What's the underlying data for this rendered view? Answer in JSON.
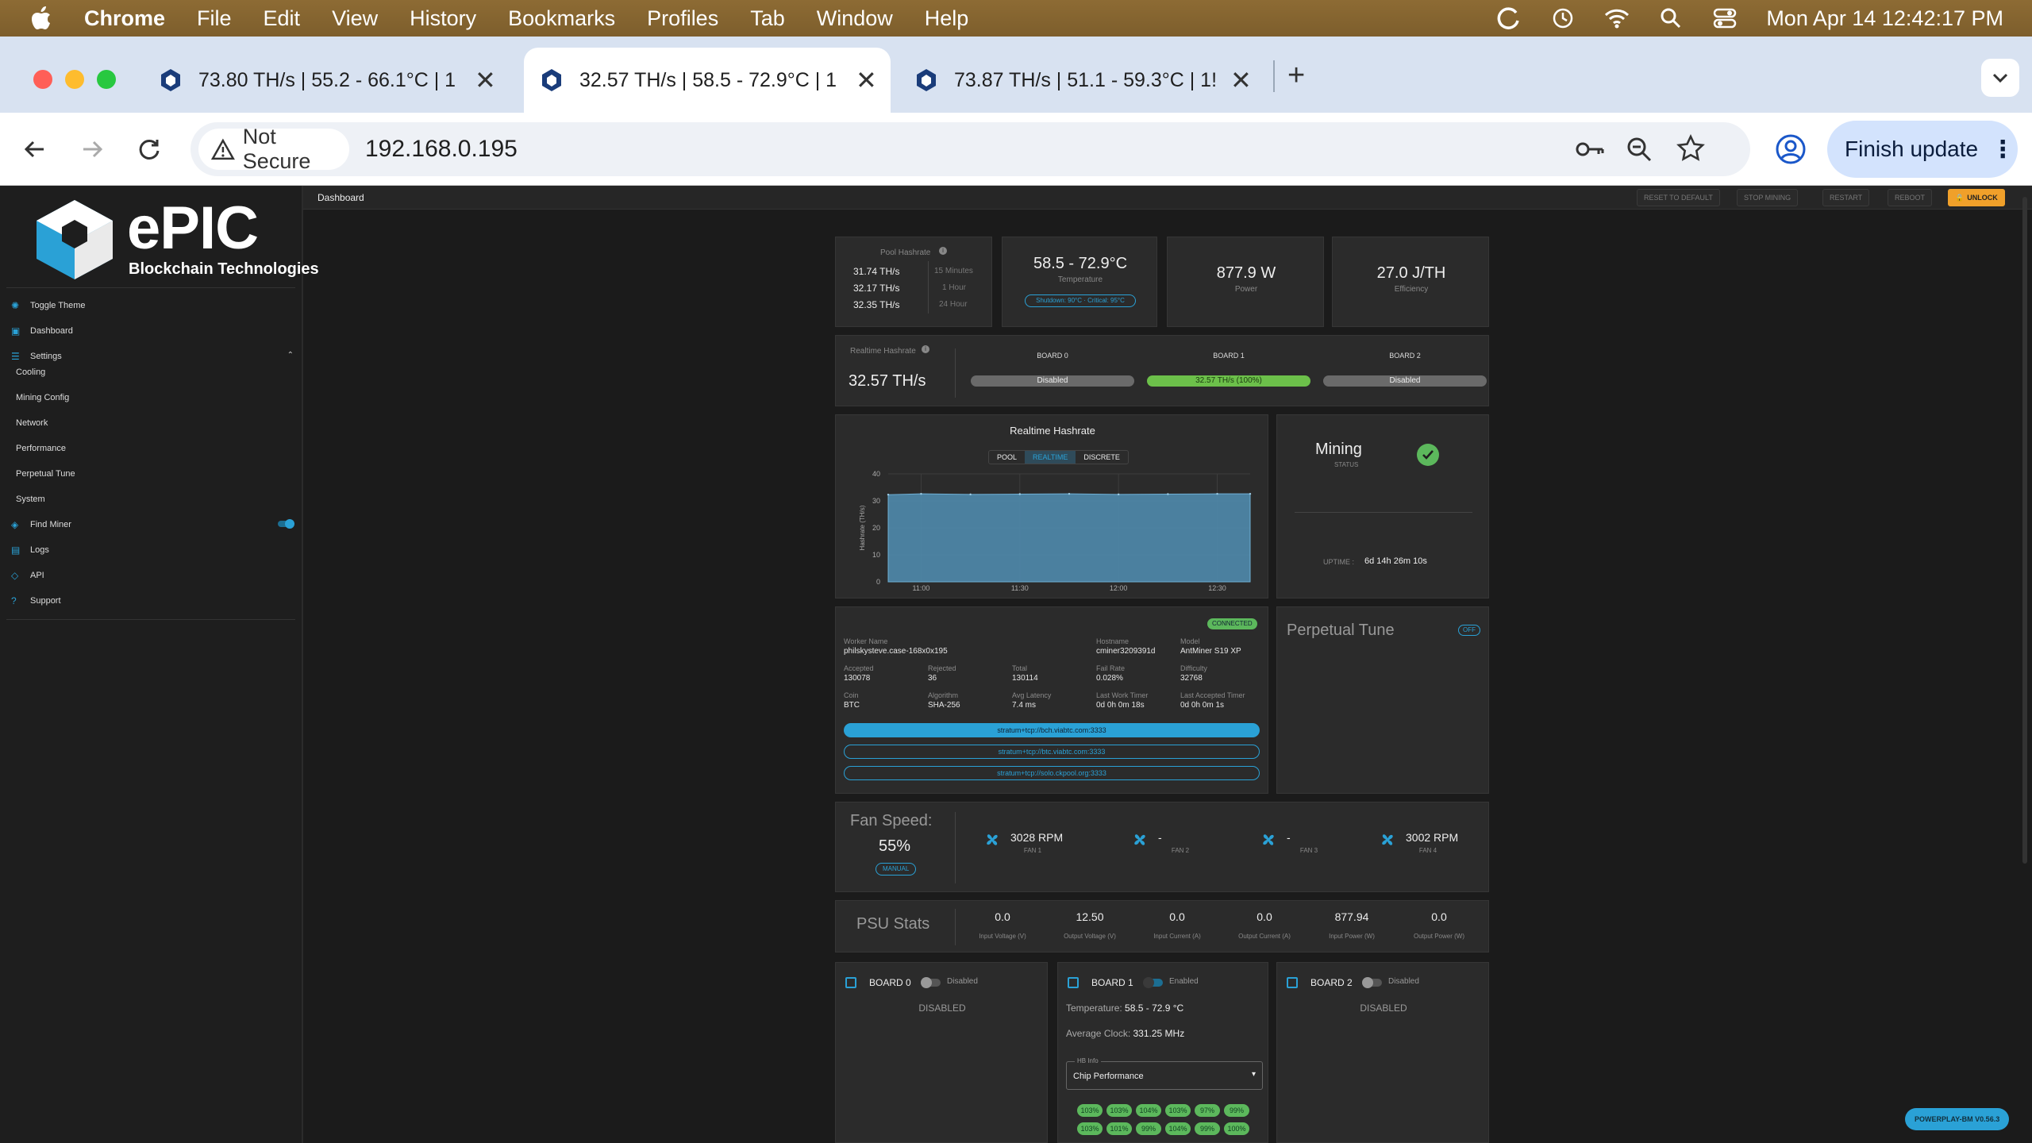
{
  "menubar": {
    "app": "Chrome",
    "items": [
      "File",
      "Edit",
      "View",
      "History",
      "Bookmarks",
      "Profiles",
      "Tab",
      "Window",
      "Help"
    ],
    "clock": "Mon Apr 14  12:42:17 PM"
  },
  "tabs": [
    {
      "title": "73.80 TH/s | 55.2 - 66.1°C | 1",
      "active": false
    },
    {
      "title": "32.57 TH/s | 58.5 - 72.9°C | 1",
      "active": true
    },
    {
      "title": "73.87 TH/s | 51.1 - 59.3°C | 1!",
      "active": false
    }
  ],
  "toolbar": {
    "security": "Not Secure",
    "url": "192.168.0.195",
    "finish_update": "Finish update"
  },
  "brand": {
    "name": "ePIC",
    "tagline": "Blockchain Technologies"
  },
  "sidebar": {
    "items": [
      {
        "label": "Toggle Theme",
        "icon": "sun-icon"
      },
      {
        "label": "Dashboard",
        "icon": "dashboard-icon"
      },
      {
        "label": "Settings",
        "icon": "settings-icon"
      },
      {
        "label": "Find Miner",
        "icon": "find-icon"
      },
      {
        "label": "Logs",
        "icon": "logs-icon"
      },
      {
        "label": "API",
        "icon": "api-icon"
      },
      {
        "label": "Support",
        "icon": "help-icon"
      }
    ],
    "settings_children": [
      "Cooling",
      "Mining Config",
      "Network",
      "Performance",
      "Perpetual Tune",
      "System"
    ]
  },
  "page": {
    "title": "Dashboard",
    "buttons": [
      "RESET TO DEFAULT",
      "STOP MINING",
      "RESTART",
      "REBOOT",
      "UNLOCK"
    ]
  },
  "pool_hashrate": {
    "title": "Pool Hashrate",
    "rows": [
      {
        "v": "31.74 TH/s",
        "p": "15 Minutes"
      },
      {
        "v": "32.17 TH/s",
        "p": "1 Hour"
      },
      {
        "v": "32.35 TH/s",
        "p": "24 Hour"
      }
    ]
  },
  "temperature": {
    "value": "58.5 - 72.9°C",
    "label": "Temperature",
    "badge": "Shutdown: 90°C · Critical: 95°C"
  },
  "power": {
    "value": "877.9 W",
    "label": "Power"
  },
  "efficiency": {
    "value": "27.0 J/TH",
    "label": "Efficiency"
  },
  "realtime": {
    "title": "Realtime Hashrate",
    "value": "32.57 TH/s",
    "boards": [
      {
        "name": "BOARD 0",
        "status": "Disabled"
      },
      {
        "name": "BOARD 1",
        "status": "32.57 TH/s (100%)"
      },
      {
        "name": "BOARD 2",
        "status": "Disabled"
      }
    ]
  },
  "chart_panel": {
    "title": "Realtime Hashrate",
    "toggles": [
      "POOL",
      "REALTIME",
      "DISCRETE"
    ]
  },
  "chart_data": {
    "type": "area",
    "title": "",
    "xlabel": "",
    "ylabel": "Hashrate (TH/s)",
    "ylim": [
      0,
      40
    ],
    "yticks": [
      0,
      10,
      20,
      30,
      40
    ],
    "xticks": [
      "11:00",
      "11:30",
      "12:00",
      "12:30"
    ],
    "x": [
      "10:50",
      "11:00",
      "11:15",
      "11:30",
      "11:45",
      "12:00",
      "12:15",
      "12:30",
      "12:40"
    ],
    "series": [
      {
        "values": [
          32.3,
          32.6,
          32.4,
          32.5,
          32.6,
          32.4,
          32.5,
          32.6,
          32.6
        ]
      }
    ],
    "color": "#4f89ac"
  },
  "status": {
    "title": "Mining",
    "label": "STATUS",
    "uptime_label": "UPTIME :",
    "uptime": "6d 14h 26m 10s"
  },
  "pool": {
    "connected": "CONNECTED",
    "fields": [
      {
        "k": "Worker Name",
        "v": "philskysteve.case-168x0x195"
      },
      {
        "k": "Hostname",
        "v": "cminer3209391d"
      },
      {
        "k": "Model",
        "v": "AntMiner S19 XP"
      },
      {
        "k": "Accepted",
        "v": "130078"
      },
      {
        "k": "Rejected",
        "v": "36"
      },
      {
        "k": "Total",
        "v": "130114"
      },
      {
        "k": "Fail Rate",
        "v": "0.028%"
      },
      {
        "k": "Difficulty",
        "v": "32768"
      },
      {
        "k": "Coin",
        "v": "BTC"
      },
      {
        "k": "Algorithm",
        "v": "SHA-256"
      },
      {
        "k": "Avg Latency",
        "v": "7.4 ms"
      },
      {
        "k": "Last Work Timer",
        "v": "0d 0h 0m 18s"
      },
      {
        "k": "Last Accepted Timer",
        "v": "0d 0h 0m 1s"
      }
    ],
    "urls": [
      "stratum+tcp://bch.viabtc.com:3333",
      "stratum+tcp://btc.viabtc.com:3333",
      "stratum+tcp://solo.ckpool.org:3333"
    ]
  },
  "perpetual": {
    "title": "Perpetual Tune",
    "state": "OFF"
  },
  "fans": {
    "title": "Fan Speed:",
    "percent": "55%",
    "mode": "MANUAL",
    "list": [
      {
        "rpm": "3028 RPM",
        "name": "FAN 1"
      },
      {
        "rpm": "-",
        "name": "FAN 2"
      },
      {
        "rpm": "-",
        "name": "FAN 3"
      },
      {
        "rpm": "3002 RPM",
        "name": "FAN 4"
      }
    ]
  },
  "psu": {
    "title": "PSU Stats",
    "stats": [
      {
        "v": "0.0",
        "k": "Input Voltage (V)"
      },
      {
        "v": "12.50",
        "k": "Output Voltage (V)"
      },
      {
        "v": "0.0",
        "k": "Input Current (A)"
      },
      {
        "v": "0.0",
        "k": "Output Current (A)"
      },
      {
        "v": "877.94",
        "k": "Input Power (W)"
      },
      {
        "v": "0.0",
        "k": "Output Power (W)"
      }
    ]
  },
  "boards": [
    {
      "name": "BOARD 0",
      "toggle": "Disabled",
      "body": "DISABLED"
    },
    {
      "name": "BOARD 1",
      "toggle": "Enabled",
      "temp_label": "Temperature:",
      "temp": "58.5 - 72.9 °C",
      "clock_label": "Average Clock:",
      "clock": "331.25 MHz",
      "select_label": "HB Info",
      "select": "Chip Performance",
      "chips": [
        "103%",
        "103%",
        "104%",
        "103%",
        "97%",
        "99%",
        "103%",
        "101%",
        "99%",
        "104%",
        "99%",
        "100%"
      ]
    },
    {
      "name": "BOARD 2",
      "toggle": "Disabled",
      "body": "DISABLED"
    }
  ],
  "version": "POWERPLAY-BM V0.56.3"
}
